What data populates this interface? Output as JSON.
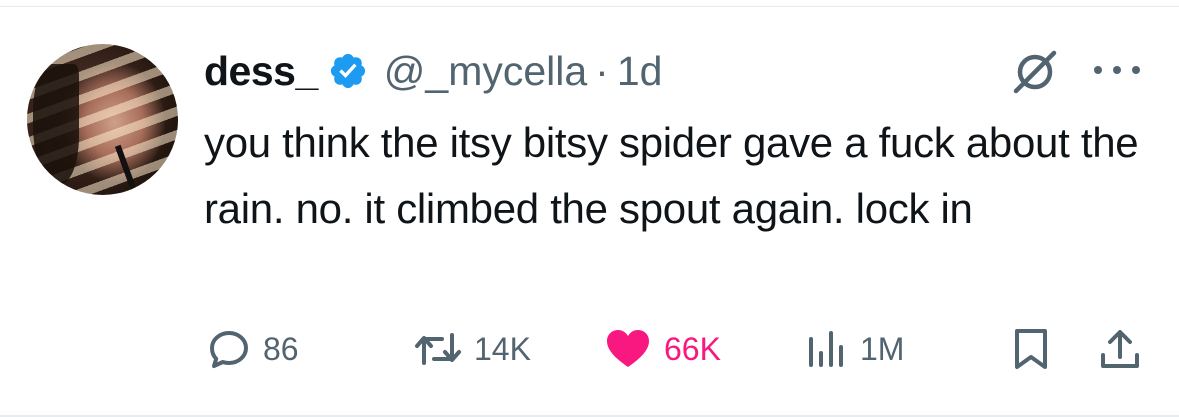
{
  "tweet": {
    "display_name": "dess_",
    "handle": "@_mycella",
    "separator": "·",
    "time": "1d",
    "text": "you think the itsy bitsy spider gave a fuck about the rain. no. it climbed the spout again. lock in"
  },
  "actions": {
    "replies": "86",
    "reposts": "14K",
    "likes": "66K",
    "views": "1M"
  },
  "icons": {
    "verified": "verified-badge-icon",
    "grok": "grok-icon",
    "more": "more-options-icon",
    "reply": "reply-icon",
    "repost": "repost-icon",
    "like": "heart-icon",
    "views": "views-chart-icon",
    "bookmark": "bookmark-icon",
    "share": "share-icon"
  },
  "colors": {
    "text": "#0f1419",
    "secondary": "#536471",
    "verified": "#1d9bf0",
    "like": "#f91880"
  }
}
